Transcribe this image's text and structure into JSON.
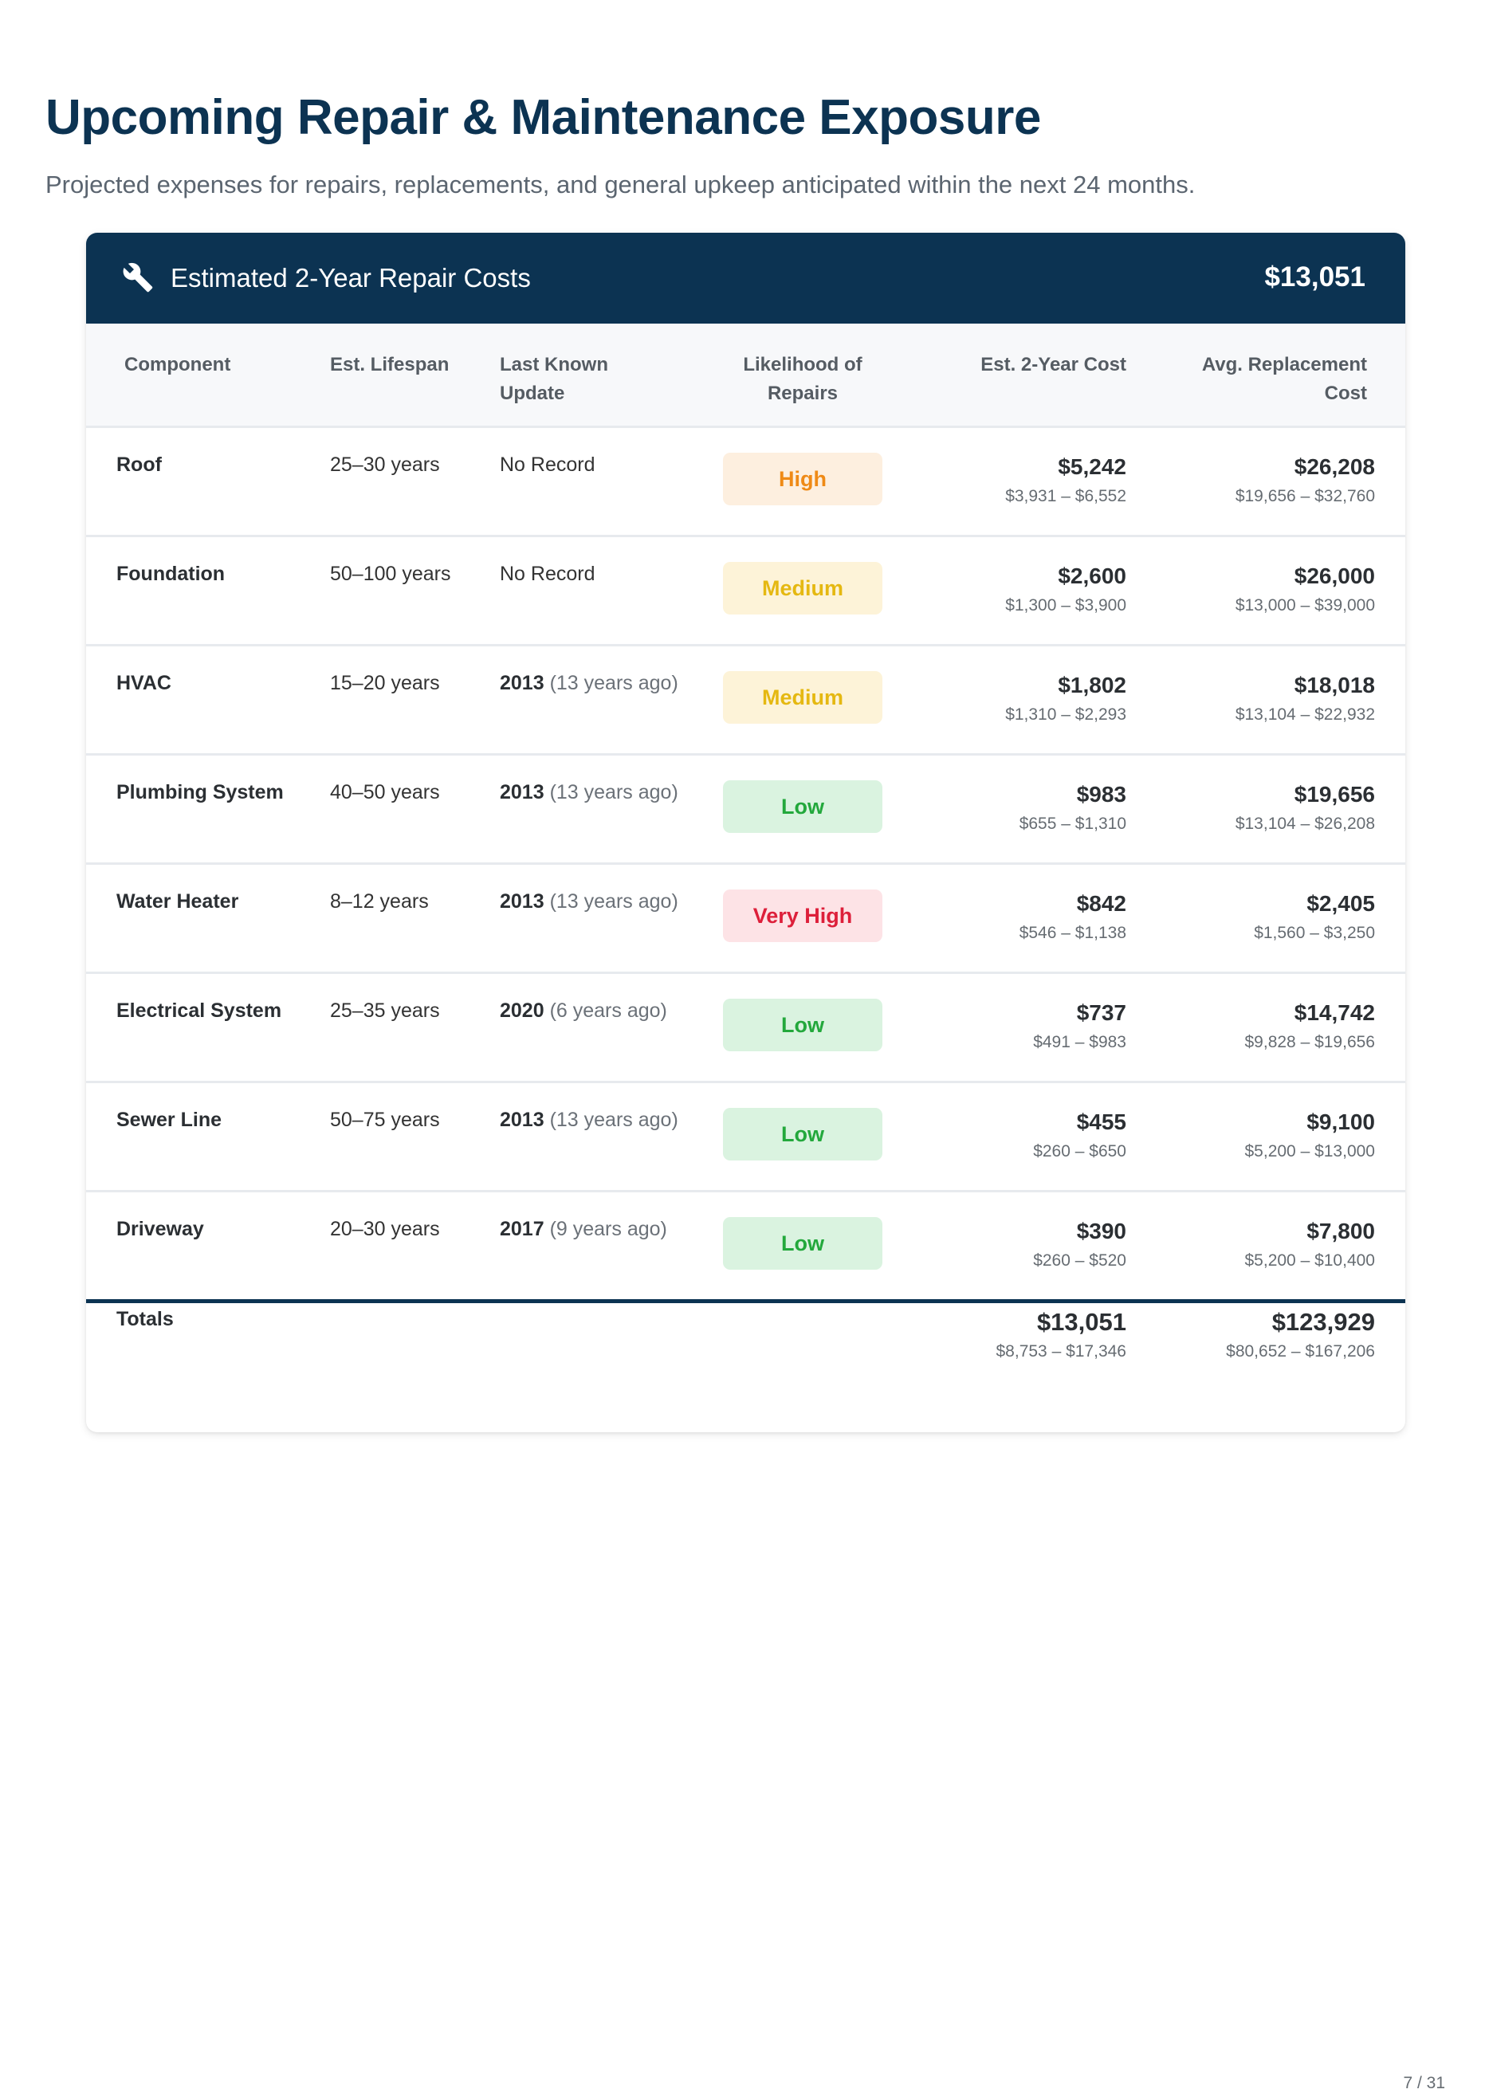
{
  "page": {
    "title": "Upcoming Repair & Maintenance Exposure",
    "subtitle": "Projected expenses for repairs, replacements, and general upkeep anticipated within the next 24 months.",
    "page_number": "7 / 31"
  },
  "card": {
    "icon": "wrench-icon",
    "title": "Estimated 2-Year Repair Costs",
    "total": "$13,051"
  },
  "columns": {
    "component": "Component",
    "lifespan": "Est. Lifespan",
    "update": "Last Known Update",
    "likelihood": "Likelihood of Repairs",
    "cost": "Est. 2-Year Cost",
    "replacement": "Avg. Replacement Cost"
  },
  "likelihood_colors": {
    "High": {
      "bg": "#fdefdf",
      "fg": "#ef8a16"
    },
    "Medium": {
      "bg": "#fdf3d8",
      "fg": "#e5b811"
    },
    "Low": {
      "bg": "#daf3e0",
      "fg": "#23a83c"
    },
    "Very High": {
      "bg": "#fde3e6",
      "fg": "#dd1f3a"
    }
  },
  "rows": [
    {
      "component": "Roof",
      "lifespan": "25–30 years",
      "update_text": "No Record",
      "update_year": "",
      "update_ago": "",
      "likelihood": "High",
      "cost": "$5,242",
      "cost_range": "$3,931 – $6,552",
      "replacement": "$26,208",
      "replacement_range": "$19,656 – $32,760"
    },
    {
      "component": "Foundation",
      "lifespan": "50–100 years",
      "update_text": "No Record",
      "update_year": "",
      "update_ago": "",
      "likelihood": "Medium",
      "cost": "$2,600",
      "cost_range": "$1,300 – $3,900",
      "replacement": "$26,000",
      "replacement_range": "$13,000 – $39,000"
    },
    {
      "component": "HVAC",
      "lifespan": "15–20 years",
      "update_text": "",
      "update_year": "2013",
      "update_ago": "(13 years ago)",
      "likelihood": "Medium",
      "cost": "$1,802",
      "cost_range": "$1,310 – $2,293",
      "replacement": "$18,018",
      "replacement_range": "$13,104 – $22,932"
    },
    {
      "component": "Plumbing System",
      "lifespan": "40–50 years",
      "update_text": "",
      "update_year": "2013",
      "update_ago": "(13 years ago)",
      "likelihood": "Low",
      "cost": "$983",
      "cost_range": "$655 – $1,310",
      "replacement": "$19,656",
      "replacement_range": "$13,104 – $26,208"
    },
    {
      "component": "Water Heater",
      "lifespan": "8–12 years",
      "update_text": "",
      "update_year": "2013",
      "update_ago": "(13 years ago)",
      "likelihood": "Very High",
      "cost": "$842",
      "cost_range": "$546 – $1,138",
      "replacement": "$2,405",
      "replacement_range": "$1,560 – $3,250"
    },
    {
      "component": "Electrical System",
      "lifespan": "25–35 years",
      "update_text": "",
      "update_year": "2020",
      "update_ago": "(6 years ago)",
      "likelihood": "Low",
      "cost": "$737",
      "cost_range": "$491 – $983",
      "replacement": "$14,742",
      "replacement_range": "$9,828 – $19,656"
    },
    {
      "component": "Sewer Line",
      "lifespan": "50–75 years",
      "update_text": "",
      "update_year": "2013",
      "update_ago": "(13 years ago)",
      "likelihood": "Low",
      "cost": "$455",
      "cost_range": "$260 – $650",
      "replacement": "$9,100",
      "replacement_range": "$5,200 – $13,000"
    },
    {
      "component": "Driveway",
      "lifespan": "20–30 years",
      "update_text": "",
      "update_year": "2017",
      "update_ago": "(9 years ago)",
      "likelihood": "Low",
      "cost": "$390",
      "cost_range": "$260 – $520",
      "replacement": "$7,800",
      "replacement_range": "$5,200 – $10,400"
    }
  ],
  "totals": {
    "label": "Totals",
    "cost": "$13,051",
    "cost_range": "$8,753 – $17,346",
    "replacement": "$123,929",
    "replacement_range": "$80,652 – $167,206"
  }
}
